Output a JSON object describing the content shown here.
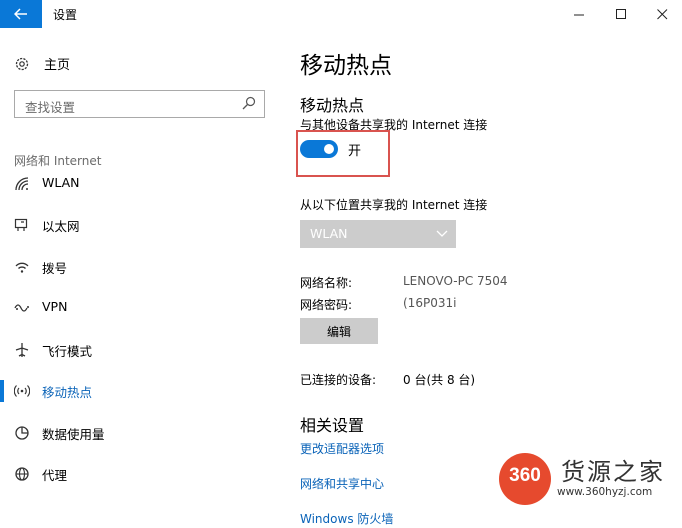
{
  "window": {
    "title": "设置"
  },
  "sidebar": {
    "home_label": "主页",
    "search_placeholder": "查找设置",
    "section_header": "网络和 Internet",
    "items": [
      {
        "label": "WLAN",
        "icon": "wifi-icon",
        "active": false
      },
      {
        "label": "以太网",
        "icon": "ethernet-icon",
        "active": false
      },
      {
        "label": "拨号",
        "icon": "dialup-icon",
        "active": false
      },
      {
        "label": "VPN",
        "icon": "vpn-icon",
        "active": false
      },
      {
        "label": "飞行模式",
        "icon": "airplane-icon",
        "active": false
      },
      {
        "label": "移动热点",
        "icon": "hotspot-icon",
        "active": true
      },
      {
        "label": "数据使用量",
        "icon": "data-usage-icon",
        "active": false
      },
      {
        "label": "代理",
        "icon": "globe-icon",
        "active": false
      }
    ]
  },
  "main": {
    "page_title": "移动热点",
    "section_title": "移动热点",
    "share_desc": "与其他设备共享我的 Internet 连接",
    "toggle_state": "开",
    "toggle_on": true,
    "share_from_label": "从以下位置共享我的 Internet 连接",
    "share_from_value": "WLAN",
    "network_name_label": "网络名称:",
    "network_name_value": "LENOVO-PC 7504",
    "network_password_label": "网络密码:",
    "network_password_value": "(16P031i",
    "edit_button": "编辑",
    "connected_label": "已连接的设备:",
    "connected_value": "0 台(共 8 台)",
    "related_title": "相关设置",
    "links": [
      "更改适配器选项",
      "网络和共享中心",
      "Windows 防火墙"
    ]
  },
  "watermark": {
    "logo_text": "360",
    "name": "货源之家",
    "url": "www.360hyzj.com"
  },
  "colors": {
    "accent": "#0a78d7",
    "link": "#0a63b8",
    "highlight_box": "#d9534f",
    "disabled": "#cccccc"
  }
}
